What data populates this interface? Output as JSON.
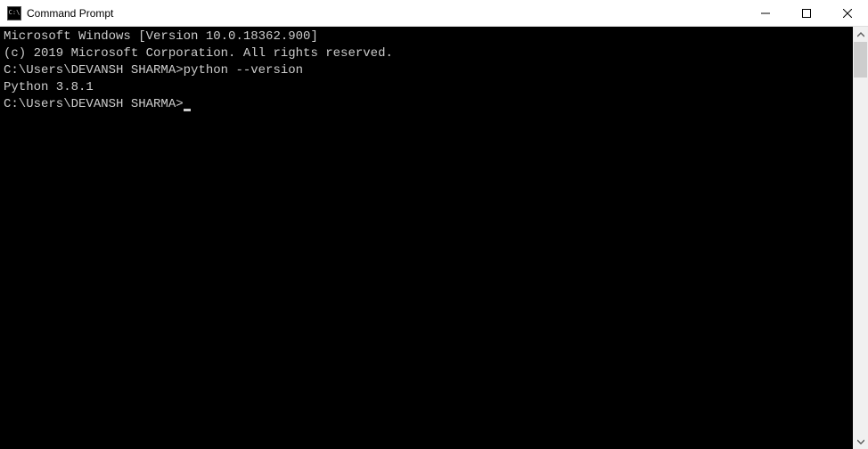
{
  "titlebar": {
    "icon_text": "C:\\",
    "title": "Command Prompt"
  },
  "terminal": {
    "line1": "Microsoft Windows [Version 10.0.18362.900]",
    "line2": "(c) 2019 Microsoft Corporation. All rights reserved.",
    "blank1": "",
    "prompt1": "C:\\Users\\DEVANSH SHARMA>",
    "command1": "python --version",
    "output1": "Python 3.8.1",
    "blank2": "",
    "prompt2": "C:\\Users\\DEVANSH SHARMA>"
  }
}
